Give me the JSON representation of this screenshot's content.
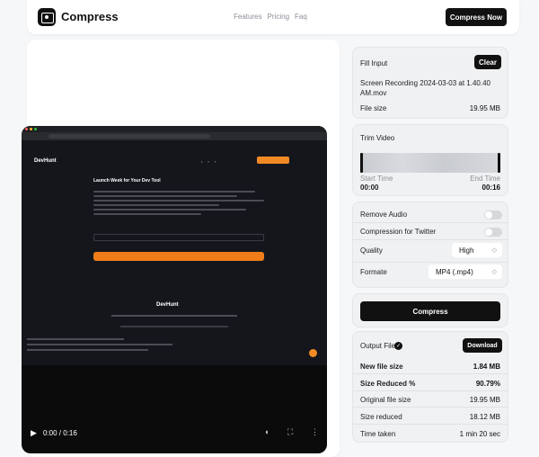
{
  "header": {
    "app_name": "Compress",
    "nav": [
      "Features",
      "Pricing",
      "Faq"
    ],
    "cta": "Compress Now"
  },
  "video": {
    "site_name": "DevHunt",
    "site_heading": "Launch Week for Your Dev Tool",
    "time": "0:00 / 0:16"
  },
  "file_input": {
    "title": "Fill Input",
    "clear": "Clear",
    "filename": "Screen Recording 2024-03-03 at 1.40.40 AM.mov",
    "size_label": "File size",
    "size_value": "19.95 MB"
  },
  "trim": {
    "title": "Trim Video",
    "start_label": "Start Time",
    "start_value": "00:00",
    "end_label": "End Time",
    "end_value": "00:16"
  },
  "options": {
    "remove_audio": "Remove Audio",
    "twitter": "Compression for Twitter",
    "quality_label": "Quality",
    "quality_value": "High",
    "format_label": "Formate",
    "format_value": "MP4 (.mp4)"
  },
  "compress": {
    "label": "Compress"
  },
  "output": {
    "title": "Output File",
    "download": "Download",
    "rows": [
      {
        "label": "New file size",
        "value": "1.84 MB",
        "bold": true
      },
      {
        "label": "Size Reduced %",
        "value": "90.79%",
        "bold": true
      },
      {
        "label": "Original file size",
        "value": "19.95 MB",
        "bold": false
      },
      {
        "label": "Size reduced",
        "value": "18.12 MB",
        "bold": false
      },
      {
        "label": "Time taken",
        "value": "1 min 20 sec",
        "bold": false
      }
    ]
  }
}
